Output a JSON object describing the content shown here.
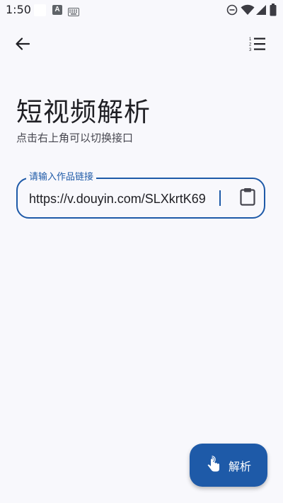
{
  "status_bar": {
    "time": "1:50",
    "a_icon_letter": "A"
  },
  "app_bar": {
    "back_icon": "arrow-back-icon",
    "menu_icon": "format-list-numbered-icon"
  },
  "header": {
    "title": "短视频解析",
    "subtitle": "点击右上角可以切换接口"
  },
  "link_field": {
    "label": "请输入作品链接",
    "value": "https://v.douyin.com/SLXkrtK69",
    "paste_icon": "clipboard-icon"
  },
  "fab": {
    "label": "解析",
    "icon": "touch-hand-icon"
  },
  "colors": {
    "accent": "#1E5AA8",
    "background": "#F8F8FC"
  }
}
